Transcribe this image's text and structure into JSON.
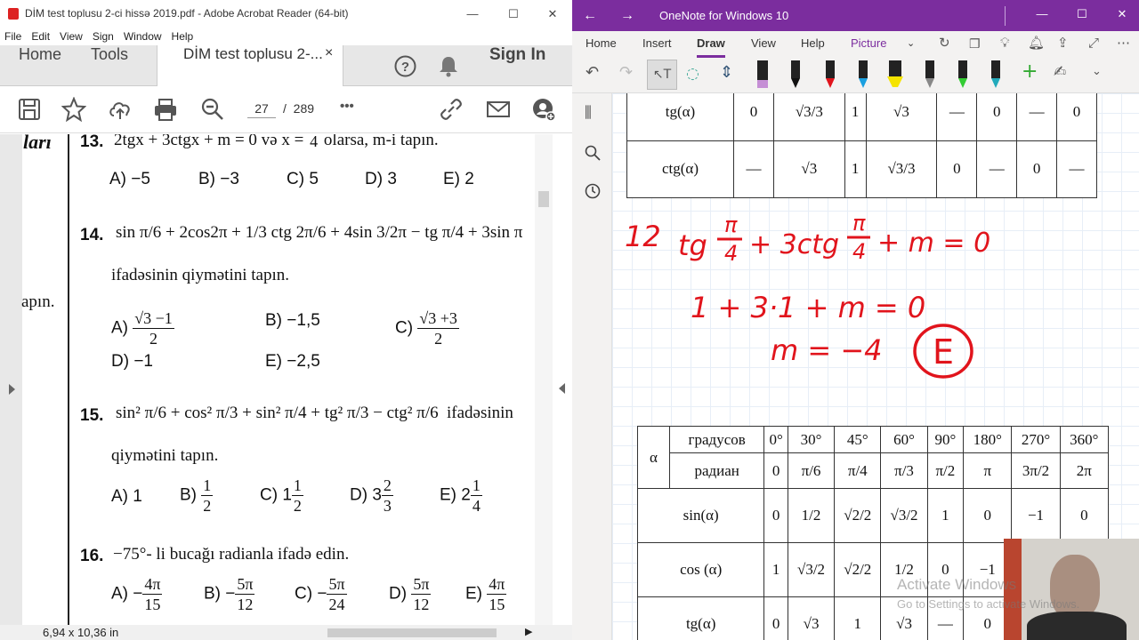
{
  "acrobat": {
    "title": "DİM test toplusu 2-ci hissə 2019.pdf - Adobe Acrobat Reader (64-bit)",
    "menu": [
      "File",
      "Edit",
      "View",
      "Sign",
      "Window",
      "Help"
    ],
    "tabs": {
      "home": "Home",
      "tools": "Tools",
      "doc": "DİM test toplusu 2-...",
      "close": "×",
      "sign_in": "Sign In"
    },
    "page_current": "27",
    "page_separator": "/",
    "page_total": "289",
    "more": "•••",
    "status_size": "6,94 x 10,36 in",
    "margin_text": {
      "lari": "ları",
      "tapin": "apın."
    },
    "q13": {
      "num": "13.",
      "text_a": "2tgx + 3ctgx + m = 0 və x =",
      "frac_n": "π",
      "frac_d": "4",
      "text_b": "olarsa, m-i tapın.",
      "options": [
        "A) −5",
        "B) −3",
        "C) 5",
        "D) 3",
        "E) 2"
      ]
    },
    "q14": {
      "num": "14.",
      "expr": "sin π/6 + 2cos2π + 1/3 ctg 2π/6 + 4sin 3/2π − tg π/4 + 3sin π",
      "line2": "ifadəsinin qiymətini tapın.",
      "opt_a_label": "A)",
      "opt_a_n": "√3 −1",
      "opt_a_d": "2",
      "opt_b": "B) −1,5",
      "opt_c_label": "C)",
      "opt_c_n": "√3 +3",
      "opt_c_d": "2",
      "opt_d": "D) −1",
      "opt_e": "E) −2,5"
    },
    "q15": {
      "num": "15.",
      "expr": "sin² π/6 + cos² π/3 + sin² π/4 + tg² π/3 − ctg² π/6",
      "expr_tail": "ifadəsinin",
      "line2": "qiymətini tapın.",
      "opt_a": "A) 1",
      "opt_b": "B)",
      "opt_b_n": "1",
      "opt_b_d": "2",
      "opt_c": "C) 1",
      "opt_c_n": "1",
      "opt_c_d": "2",
      "opt_d": "D) 3",
      "opt_d_n": "2",
      "opt_d_d": "3",
      "opt_e": "E) 2",
      "opt_e_n": "1",
      "opt_e_d": "4"
    },
    "q16": {
      "num": "16.",
      "text": "−75°- li bucağı radianla ifadə edin.",
      "opt_a": "A) −",
      "a_n": "4π",
      "a_d": "15",
      "opt_b": "B) −",
      "b_n": "5π",
      "b_d": "12",
      "opt_c": "C) −",
      "c_n": "5π",
      "c_d": "24",
      "opt_d": "D)",
      "d_n": "5π",
      "d_d": "12",
      "opt_e": "E)",
      "e_n": "4π",
      "e_d": "15"
    }
  },
  "onenote": {
    "title": "OneNote for Windows 10",
    "ribbon_tabs": [
      "Home",
      "Insert",
      "Draw",
      "View",
      "Help",
      "Picture"
    ],
    "active_tab": "Draw",
    "accent": "#7b2d9e",
    "top_table": {
      "rows": [
        {
          "label": "tg(α)",
          "cells": [
            "0",
            "√3/3",
            "1",
            "√3",
            "—",
            "0",
            "—",
            "0"
          ]
        },
        {
          "label": "ctg(α)",
          "cells": [
            "—",
            "√3",
            "1",
            "√3/3",
            "0",
            "—",
            "0",
            "—"
          ]
        }
      ]
    },
    "handwriting": {
      "line1": "12  tg π/4 + 3ctg π/4 + m = 0",
      "line1_num": "12",
      "line1_expr": "tg",
      "frac1_n": "π",
      "frac1_d": "4",
      "plus3ctg": "+ 3ctg",
      "frac2_n": "π",
      "frac2_d": "4",
      "eq_tail": "+ m = 0",
      "line2": "1 + 3·1 + m = 0",
      "line3": "m = −4",
      "answer": "E",
      "ink_color": "#e1141c"
    },
    "bottom_table": {
      "head1": [
        "α",
        "градусов",
        "0°",
        "30°",
        "45°",
        "60°",
        "90°",
        "180°",
        "270°",
        "360°"
      ],
      "head2": [
        "радиан",
        "0",
        "π/6",
        "π/4",
        "π/3",
        "π/2",
        "π",
        "3π/2",
        "2π"
      ],
      "rows": [
        {
          "label": "sin(α)",
          "cells": [
            "0",
            "1/2",
            "√2/2",
            "√3/2",
            "1",
            "0",
            "−1",
            "0"
          ]
        },
        {
          "label": "cos (α)",
          "cells": [
            "1",
            "√3/2",
            "√2/2",
            "1/2",
            "0",
            "−1",
            "",
            ""
          ]
        },
        {
          "label": "tg(α)",
          "cells": [
            "0",
            "√3",
            "1",
            "√3",
            "—",
            "0",
            "",
            ""
          ]
        }
      ]
    },
    "watermark": "Activate Windows",
    "watermark_sub": "Go to Settings to activate Windows."
  }
}
